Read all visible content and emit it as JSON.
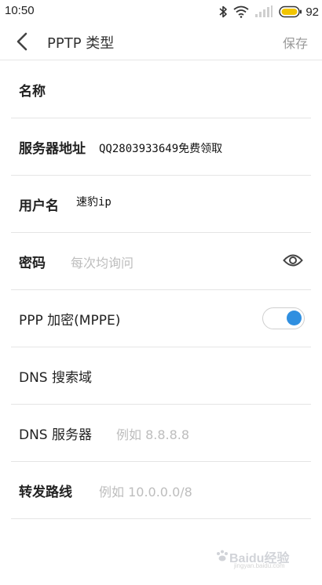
{
  "status_bar": {
    "time": "10:50",
    "battery_percent": "92",
    "icons": [
      "bluetooth-icon",
      "wifi-icon",
      "signal-icon",
      "battery-icon"
    ],
    "battery_color": "#f2c500"
  },
  "header": {
    "title": "PPTP 类型",
    "save_label": "保存",
    "back_icon": "chevron-left-icon"
  },
  "form": {
    "name": {
      "label": "名称",
      "value": ""
    },
    "server": {
      "label": "服务器地址",
      "value": "QQ2803933649免费领取"
    },
    "username": {
      "label": "用户名",
      "value": "速豹ip"
    },
    "password": {
      "label": "密码",
      "placeholder": "每次均询问",
      "icon": "eye-icon"
    },
    "ppp_encryption": {
      "label": "PPP 加密(MPPE)",
      "enabled": true
    },
    "dns_search": {
      "label": "DNS 搜索域",
      "value": ""
    },
    "dns_server": {
      "label": "DNS 服务器",
      "placeholder": "例如 8.8.8.8"
    },
    "forward_routes": {
      "label": "转发路线",
      "placeholder": "例如 10.0.0.0/8"
    }
  },
  "colors": {
    "accent": "#2f8fe0",
    "placeholder": "#bdbdbd",
    "divider": "#e5e5e5"
  },
  "watermark": {
    "text": "Baidu经验",
    "sub": "jingyan.baidu.com"
  }
}
